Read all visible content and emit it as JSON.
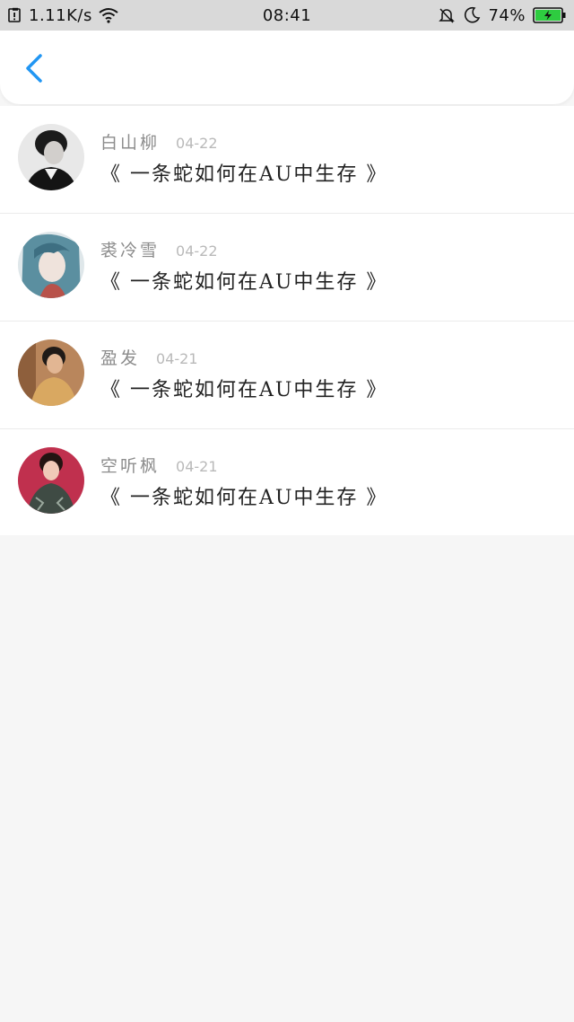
{
  "status_bar": {
    "network_speed": "1.11K/s",
    "time": "08:41",
    "battery_percent": "74%",
    "icons": [
      "notification-icon",
      "wifi-icon",
      "silent-bell-icon",
      "moon-icon",
      "battery-icon"
    ],
    "battery_color": "#2ecc40"
  },
  "header": {
    "back_icon": "chevron-left-icon",
    "accent_color": "#2196f3"
  },
  "items": [
    {
      "author": "白山柳",
      "date": "04-22",
      "title": "《 一条蛇如何在AU中生存 》",
      "avatar": "avatar-photo"
    },
    {
      "author": "裘冷雪",
      "date": "04-22",
      "title": "《 一条蛇如何在AU中生存 》",
      "avatar": "avatar-illustration"
    },
    {
      "author": "盈发",
      "date": "04-21",
      "title": "《 一条蛇如何在AU中生存 》",
      "avatar": "avatar-photo"
    },
    {
      "author": "空听枫",
      "date": "04-21",
      "title": "《 一条蛇如何在AU中生存 》",
      "avatar": "avatar-photo"
    }
  ]
}
